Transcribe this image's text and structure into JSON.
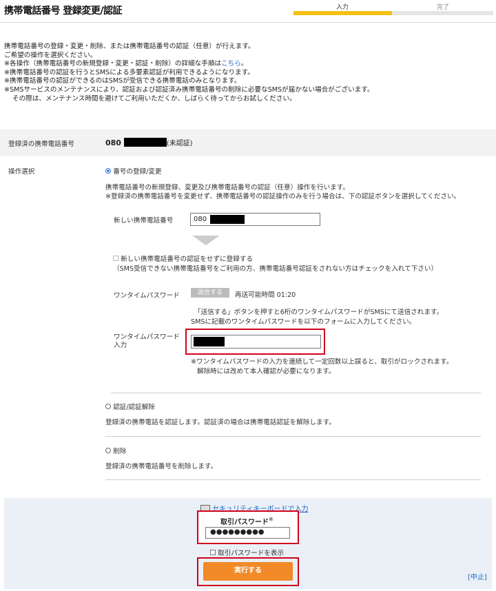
{
  "page": {
    "title": "携帯電話番号 登録変更/認証"
  },
  "progress": {
    "step1": "入力",
    "step2": "完了",
    "current_step": 1,
    "total_steps": 2
  },
  "intro": {
    "line1": "携帯電話番号の登録・変更・削除、または携帯電話番号の認証（任意）が行えます。",
    "line2": "ご希望の操作を選択ください。",
    "line3_pre": "※各操作（携帯電話番号の新規登録・変更・認証・削除）の詳細な手順は",
    "line3_link": "こちら",
    "line3_post": "。",
    "line4": "※携帯電話番号の認証を行うとSMSによる多要素認証が利用できるようになります。",
    "line5": "※携帯電話番号の認証ができるのはSMSが受信できる携帯電話のみとなります。",
    "line6": "※SMSサービスのメンテナンスにより、認証および認証済み携帯電話番号の削除に必要なSMSが届かない場合がございます。",
    "line7": "その際は、メンテナンス時間を避けてご利用いただくか、しばらく待ってからお試しください。"
  },
  "registered": {
    "label": "登録済の携帯電話番号",
    "prefix": "080",
    "status": "(未認証)"
  },
  "operation": {
    "label": "操作選択",
    "option1": {
      "label": "番号の登録/変更",
      "desc1": "携帯電話番号の新規登録、変更及び携帯電話番号の認証（任意）操作を行います。",
      "desc2": "※登録済の携帯電話番号を変更せず、携帯電話番号の認証操作のみを行う場合は、下の認証ボタンを選択してください。",
      "new_number_label": "新しい携帯電話番号",
      "new_number_value": "080",
      "skip_auth_label": "新しい携帯電話番号の認証をせずに登録する",
      "skip_auth_note": "（SMS受信できない携帯電話番号をご利用の方、携帯電話番号認証をされない方はチェックを入れて下さい）",
      "otp_label": "ワンタイムパスワード",
      "send_button": "送信する",
      "resend_label": "再送可能時間",
      "resend_time": "01:20",
      "send_note1": "「送信する」ボタンを押すと6桁のワンタイムパスワードがSMSにて送信されます。",
      "send_note2": "SMSに記載のワンタイムパスワードを以下のフォームに入力してください。",
      "otp_input_label1": "ワンタイムパスワード",
      "otp_input_label2": "入力",
      "lock_note1": "※ワンタイムパスワードの入力を連続して一定回数以上誤ると、取引がロックされます。",
      "lock_note2": "解除時には改めて本人確認が必要になります。"
    },
    "option2": {
      "label": "認証/認証解除",
      "desc": "登録済の携帯電話を認証します。認証済の場合は携帯電話認証を解除します。"
    },
    "option3": {
      "label": "削除",
      "desc": "登録済の携帯電話番号を削除します。"
    }
  },
  "bottom": {
    "secure_keyboard": "セキュリティキーボードで入力",
    "password_label": "取引パスワード",
    "password_required_mark": "※",
    "password_value": "●●●●●●●●●",
    "show_password": "取引パスワードを表示",
    "execute": "実行する",
    "cancel": "[中止]"
  },
  "colors": {
    "accent_yellow": "#f5c016",
    "execute_orange": "#f28a28",
    "link_blue": "#1a62c6",
    "highlight_red": "#d0021b"
  }
}
